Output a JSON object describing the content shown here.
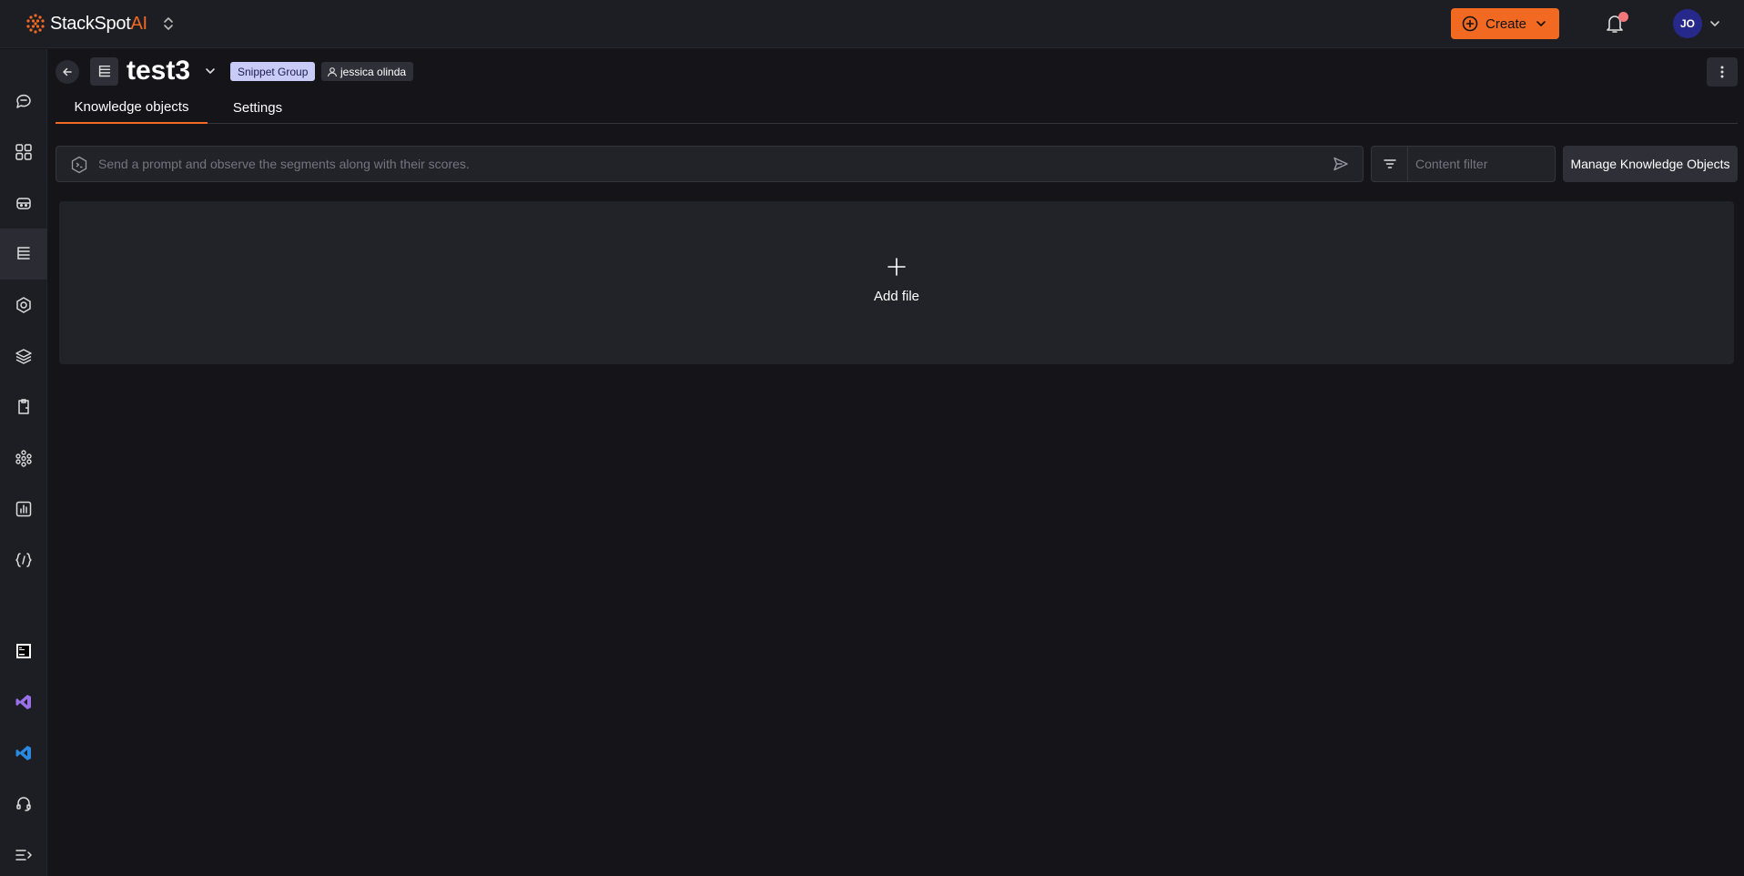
{
  "topbar": {
    "logo_text_main": "StackSpot",
    "logo_text_accent": "AI",
    "create_label": "Create",
    "avatar_initials": "JO"
  },
  "sidebar": {
    "items": [
      {
        "icon": "chat-icon",
        "label": "Chat"
      },
      {
        "icon": "dashboard-icon",
        "label": "Dashboard"
      },
      {
        "icon": "agent-icon",
        "label": "Agents"
      },
      {
        "icon": "knowledge-sources-icon",
        "label": "Knowledge Sources",
        "active": true
      },
      {
        "icon": "shield-icon",
        "label": "Guardrails"
      },
      {
        "icon": "layers-icon",
        "label": "Stacks"
      },
      {
        "icon": "clipboard-icon",
        "label": "Quick Commands"
      },
      {
        "icon": "cluster-icon",
        "label": "Workspaces"
      },
      {
        "icon": "chart-icon",
        "label": "Insights"
      },
      {
        "icon": "code-braces-icon",
        "label": "Variables"
      }
    ],
    "bottom_items": [
      {
        "icon": "jetbrains-icon"
      },
      {
        "icon": "vs-icon"
      },
      {
        "icon": "vscode-icon"
      },
      {
        "icon": "headset-icon"
      },
      {
        "icon": "collapse-menu-icon"
      }
    ]
  },
  "header": {
    "title": "test3",
    "type_badge": "Snippet Group",
    "owner": "jessica olinda"
  },
  "tabs": [
    {
      "label": "Knowledge objects",
      "active": true
    },
    {
      "label": "Settings",
      "active": false
    }
  ],
  "search": {
    "prompt_placeholder": "Send a prompt and observe the segments along with their scores.",
    "filter_placeholder": "Content filter",
    "manage_label": "Manage Knowledge Objects"
  },
  "dropzone": {
    "label": "Add file"
  },
  "colors": {
    "accent": "#f26a21",
    "background": "#141419",
    "panel": "#1d1e24",
    "badge": "#c9cbf7",
    "avatar": "#27298a",
    "notification_dot": "#f0787a"
  }
}
